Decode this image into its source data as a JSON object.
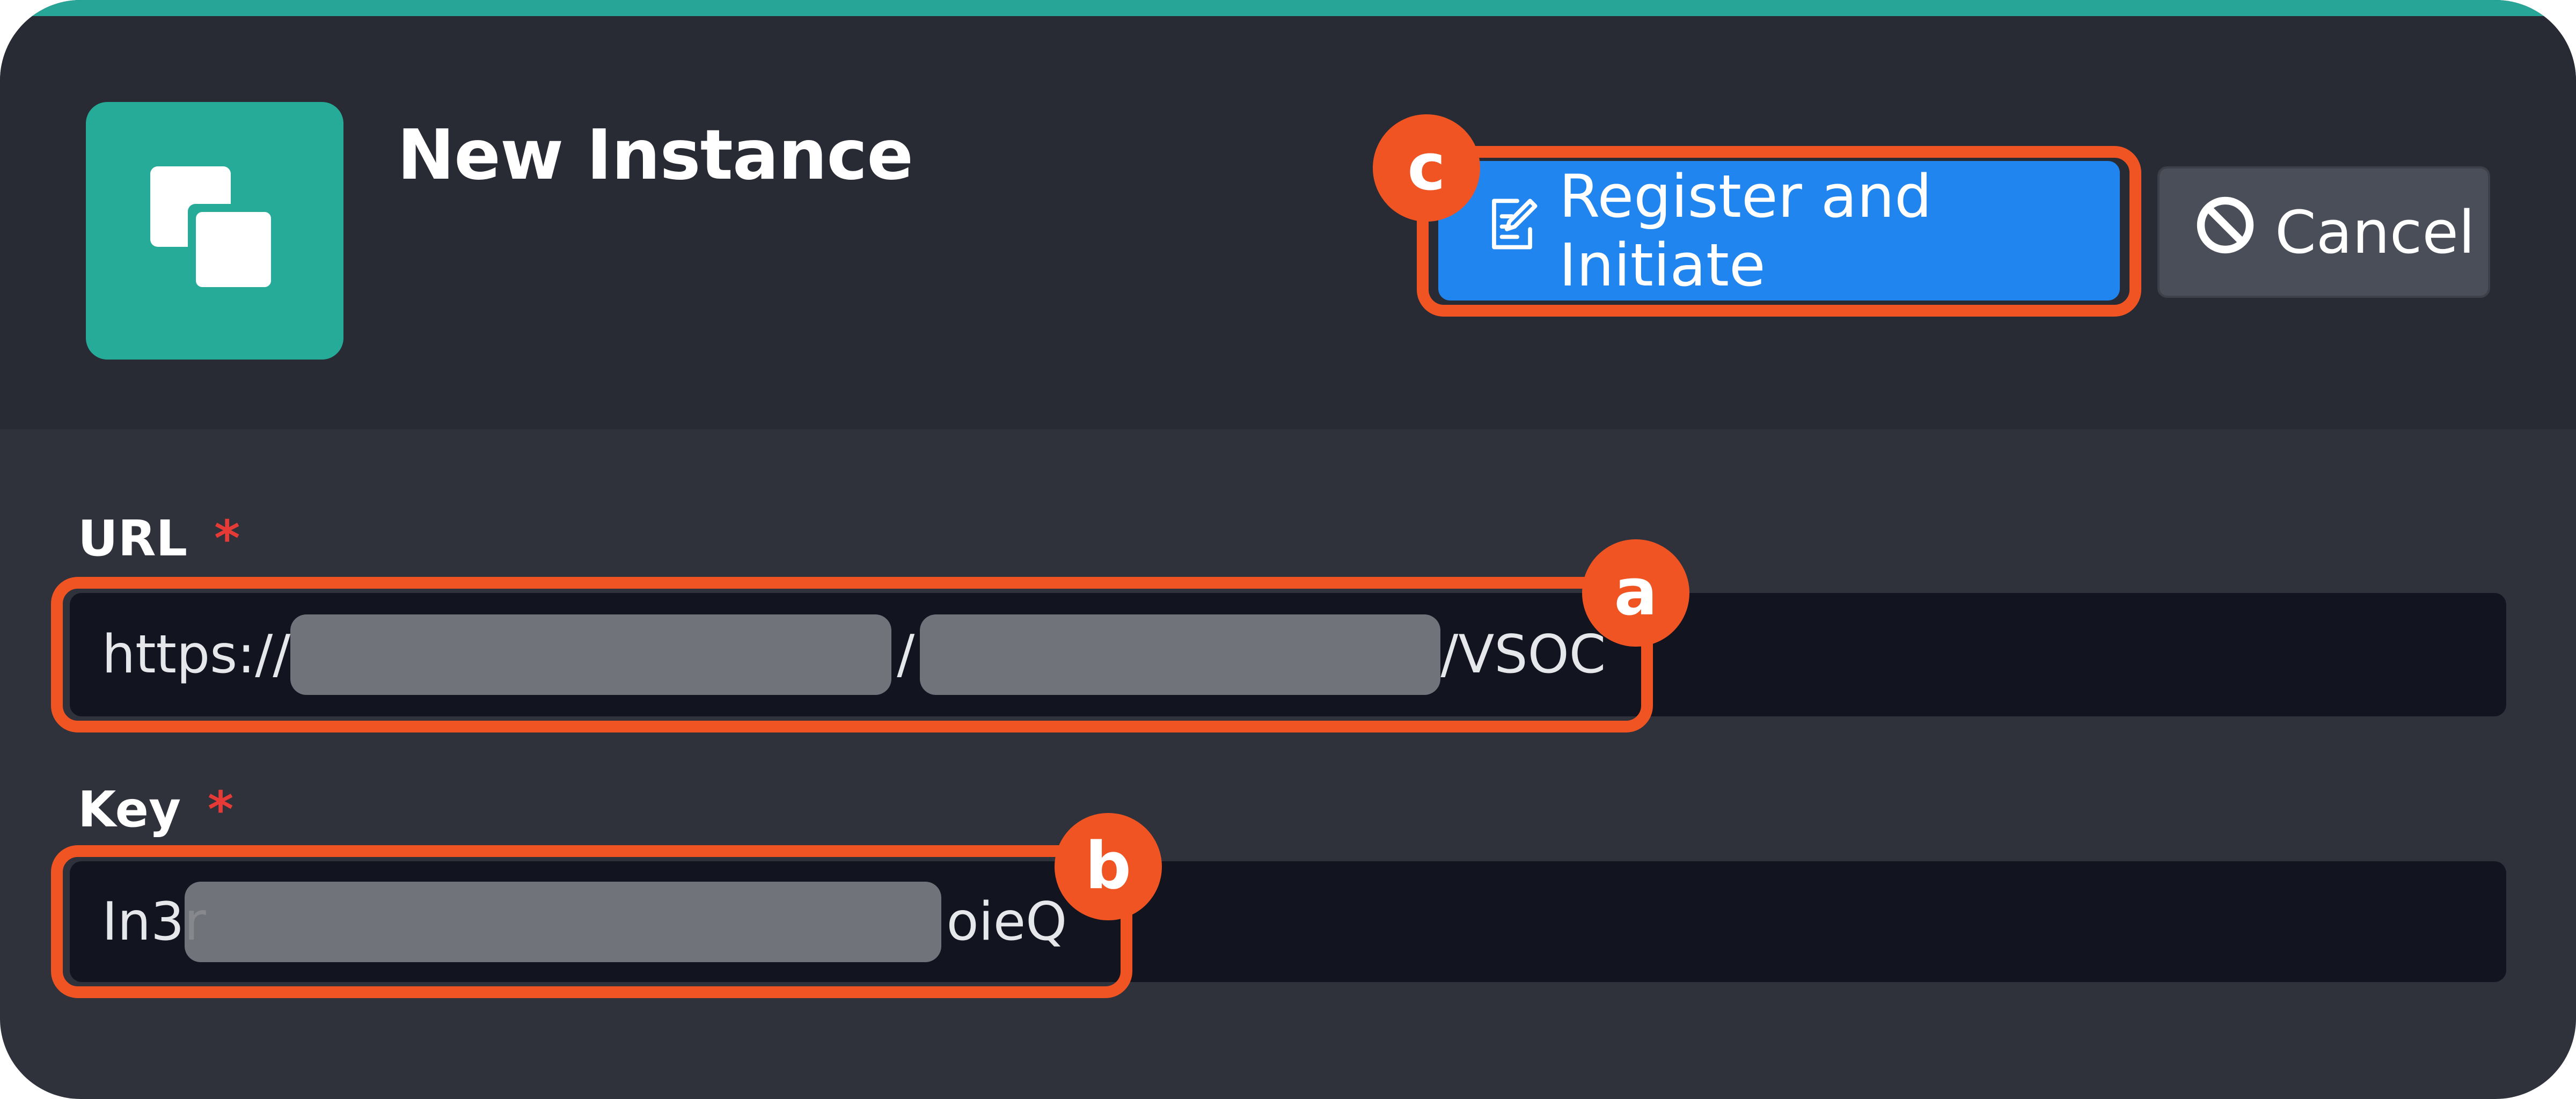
{
  "dialog": {
    "title": "New Instance",
    "app_icon": "copy-windows-icon"
  },
  "actions": {
    "register_label": "Register and Initiate",
    "register_icon": "edit-document-icon",
    "cancel_label": "Cancel",
    "cancel_icon": "ban-circle-icon"
  },
  "fields": {
    "url": {
      "label": "URL",
      "required_marker": "*",
      "value_prefix": "https://",
      "separator": "/",
      "value_suffix": "/VSOC"
    },
    "key": {
      "label": "Key",
      "required_marker": "*",
      "value_prefix": "In3r",
      "value_suffix": "oieQ"
    }
  },
  "annotations": {
    "a": "a",
    "b": "b",
    "c": "c"
  },
  "colors": {
    "accent": "#27a596",
    "primary_button": "#2185f0",
    "highlight": "#f05422",
    "required": "#e53a36"
  }
}
